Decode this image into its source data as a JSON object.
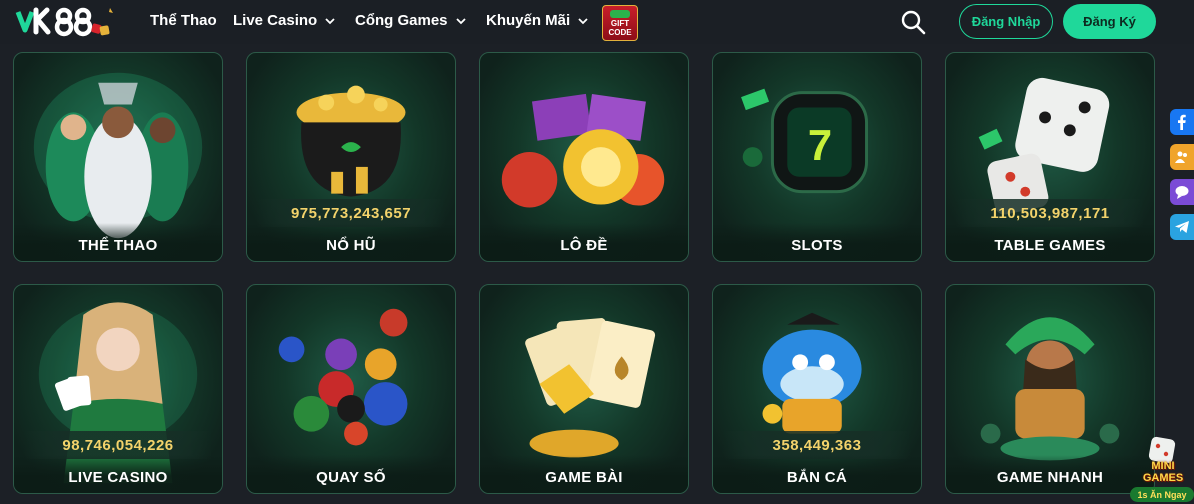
{
  "nav": {
    "logo_text": "VK88",
    "items": [
      {
        "label": "Thể Thao",
        "has_dropdown": false
      },
      {
        "label": "Live Casino",
        "has_dropdown": true
      },
      {
        "label": "Cổng Games",
        "has_dropdown": true
      },
      {
        "label": "Khuyến Mãi",
        "has_dropdown": true
      }
    ],
    "gift_code": {
      "line1": "GIFT",
      "line2": "CODE"
    },
    "login_label": "Đăng Nhập",
    "register_label": "Đăng Ký",
    "accent_color": "#1fd89a"
  },
  "games": [
    {
      "label": "THỂ THAO",
      "jackpot": null,
      "art": "football-players"
    },
    {
      "label": "NỔ HŨ",
      "jackpot": "975,773,243,657",
      "art": "gold-pot"
    },
    {
      "label": "LÔ ĐỀ",
      "jackpot": null,
      "art": "lottery-balls"
    },
    {
      "label": "SLOTS",
      "jackpot": null,
      "art": "slot-reels"
    },
    {
      "label": "TABLE GAMES",
      "jackpot": "110,503,987,171",
      "art": "dice"
    },
    {
      "label": "LIVE CASINO",
      "jackpot": "98,746,054,226",
      "art": "dealer-cards"
    },
    {
      "label": "QUAY SỐ",
      "jackpot": null,
      "art": "billiard-balls"
    },
    {
      "label": "GAME BÀI",
      "jackpot": null,
      "art": "playing-cards"
    },
    {
      "label": "BẮN CÁ",
      "jackpot": "358,449,363",
      "art": "fish-shooter"
    },
    {
      "label": "GAME NHANH",
      "jackpot": null,
      "art": "tribal-girl"
    }
  ],
  "side_links": [
    {
      "icon": "facebook-icon",
      "color": "#1877f2"
    },
    {
      "icon": "group-icon",
      "color": "#f0a42b"
    },
    {
      "icon": "chat-icon",
      "color": "#7b4bd6"
    },
    {
      "icon": "telegram-icon",
      "color": "#2aa3e0"
    }
  ],
  "mini_games": {
    "title": "MINI GAMES",
    "tagline": "1s Ăn Ngay"
  }
}
